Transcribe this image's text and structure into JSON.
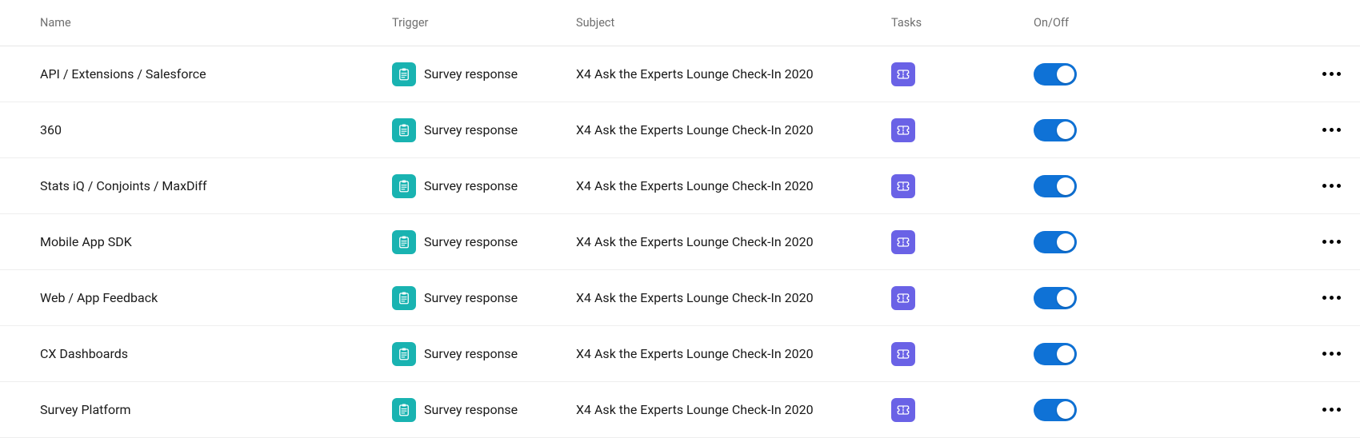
{
  "columns": {
    "name": "Name",
    "trigger": "Trigger",
    "subject": "Subject",
    "tasks": "Tasks",
    "onoff": "On/Off"
  },
  "icons": {
    "trigger": "survey-response-icon",
    "task": "ticket-icon"
  },
  "colors": {
    "trigger_icon_bg": "#19b3b1",
    "task_icon_bg": "#6a62e6",
    "toggle_on": "#0f72d6"
  },
  "rows": [
    {
      "name": "API / Extensions / Salesforce",
      "trigger": "Survey response",
      "subject": "X4 Ask the Experts Lounge Check-In 2020",
      "task": "ticket",
      "on": true
    },
    {
      "name": "360",
      "trigger": "Survey response",
      "subject": "X4 Ask the Experts Lounge Check-In 2020",
      "task": "ticket",
      "on": true
    },
    {
      "name": "Stats iQ / Conjoints / MaxDiff",
      "trigger": "Survey response",
      "subject": "X4 Ask the Experts Lounge Check-In 2020",
      "task": "ticket",
      "on": true
    },
    {
      "name": "Mobile App SDK",
      "trigger": "Survey response",
      "subject": "X4 Ask the Experts Lounge Check-In 2020",
      "task": "ticket",
      "on": true
    },
    {
      "name": "Web / App Feedback",
      "trigger": "Survey response",
      "subject": "X4 Ask the Experts Lounge Check-In 2020",
      "task": "ticket",
      "on": true
    },
    {
      "name": "CX Dashboards",
      "trigger": "Survey response",
      "subject": "X4 Ask the Experts Lounge Check-In 2020",
      "task": "ticket",
      "on": true
    },
    {
      "name": "Survey Platform",
      "trigger": "Survey response",
      "subject": "X4 Ask the Experts Lounge Check-In 2020",
      "task": "ticket",
      "on": true
    }
  ]
}
